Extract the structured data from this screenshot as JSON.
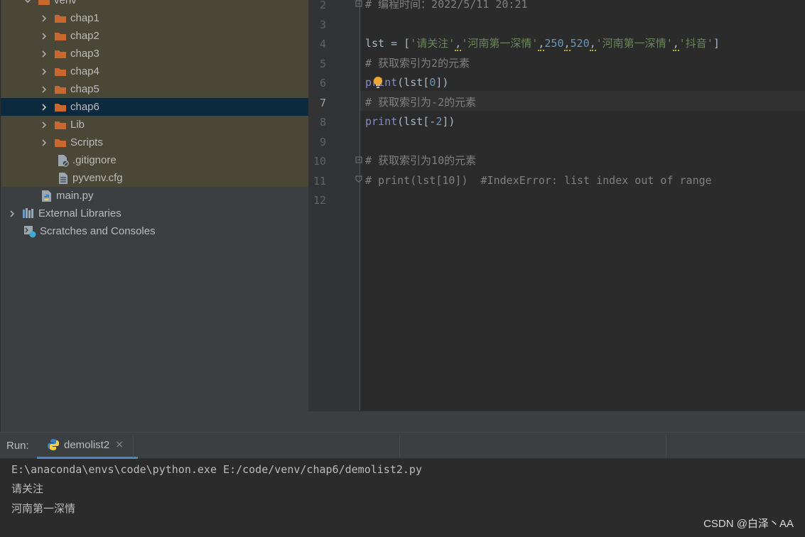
{
  "project_tree": {
    "items": [
      {
        "label": "venv",
        "type": "folder",
        "expanded": true
      },
      {
        "label": "chap1",
        "type": "folder"
      },
      {
        "label": "chap2",
        "type": "folder"
      },
      {
        "label": "chap3",
        "type": "folder"
      },
      {
        "label": "chap4",
        "type": "folder"
      },
      {
        "label": "chap5",
        "type": "folder"
      },
      {
        "label": "chap6",
        "type": "folder",
        "selected": true
      },
      {
        "label": "Lib",
        "type": "folder"
      },
      {
        "label": "Scripts",
        "type": "folder"
      },
      {
        "label": ".gitignore",
        "type": "file"
      },
      {
        "label": "pyvenv.cfg",
        "type": "file"
      },
      {
        "label": "main.py",
        "type": "python-file"
      },
      {
        "label": "External Libraries",
        "type": "libraries"
      },
      {
        "label": "Scratches and Consoles",
        "type": "scratches"
      }
    ]
  },
  "editor": {
    "current_line": 7,
    "lines": [
      {
        "num": "2",
        "tokens": [
          {
            "t": "# 编程时间：2022/5/11 20:21",
            "c": "comment"
          }
        ]
      },
      {
        "num": "3",
        "tokens": []
      },
      {
        "num": "4",
        "tokens": [
          {
            "t": "lst = [",
            "c": "default"
          },
          {
            "t": "'请关注'",
            "c": "string"
          },
          {
            "t": ",",
            "c": "warn"
          },
          {
            "t": "'河南第一深情'",
            "c": "string"
          },
          {
            "t": ",",
            "c": "warn"
          },
          {
            "t": "250",
            "c": "number"
          },
          {
            "t": ",",
            "c": "warn"
          },
          {
            "t": "520",
            "c": "number"
          },
          {
            "t": ",",
            "c": "warn"
          },
          {
            "t": "'河南第一深情'",
            "c": "string"
          },
          {
            "t": ",",
            "c": "warn"
          },
          {
            "t": "'抖音'",
            "c": "string"
          },
          {
            "t": "]",
            "c": "default"
          }
        ]
      },
      {
        "num": "5",
        "tokens": [
          {
            "t": "# 获取索引为2的元素",
            "c": "comment"
          }
        ]
      },
      {
        "num": "6",
        "tokens": [
          {
            "t": "print",
            "c": "builtin"
          },
          {
            "t": "(lst[",
            "c": "default"
          },
          {
            "t": "0",
            "c": "number"
          },
          {
            "t": "])",
            "c": "default"
          }
        ]
      },
      {
        "num": "7",
        "tokens": [
          {
            "t": "# 获取索引为-2的元素",
            "c": "comment"
          }
        ]
      },
      {
        "num": "8",
        "tokens": [
          {
            "t": "print",
            "c": "builtin"
          },
          {
            "t": "(lst[-",
            "c": "default"
          },
          {
            "t": "2",
            "c": "number"
          },
          {
            "t": "])",
            "c": "default"
          }
        ]
      },
      {
        "num": "9",
        "tokens": []
      },
      {
        "num": "10",
        "tokens": [
          {
            "t": "# 获取索引为10的元素",
            "c": "comment"
          }
        ]
      },
      {
        "num": "11",
        "tokens": [
          {
            "t": "# print(lst[10])  #IndexError: list index out of range",
            "c": "comment"
          }
        ]
      },
      {
        "num": "12",
        "tokens": []
      }
    ]
  },
  "run": {
    "label": "Run:",
    "tab_label": "demolist2",
    "tab_close": "×",
    "console": [
      "E:\\anaconda\\envs\\code\\python.exe E:/code/venv/chap6/demolist2.py",
      "请关注",
      "河南第一深情"
    ]
  },
  "watermark": "CSDN @白泽丶AA",
  "colors": {
    "tree_bg": "#3c3f41",
    "venv_highlight": "#4a4737",
    "selection": "#0d293e",
    "folder": "#c8682f",
    "editor_bg": "#2b2b2b",
    "comment": "#808080",
    "string": "#6a8759",
    "number": "#6897bb",
    "builtin": "#8888c6"
  }
}
